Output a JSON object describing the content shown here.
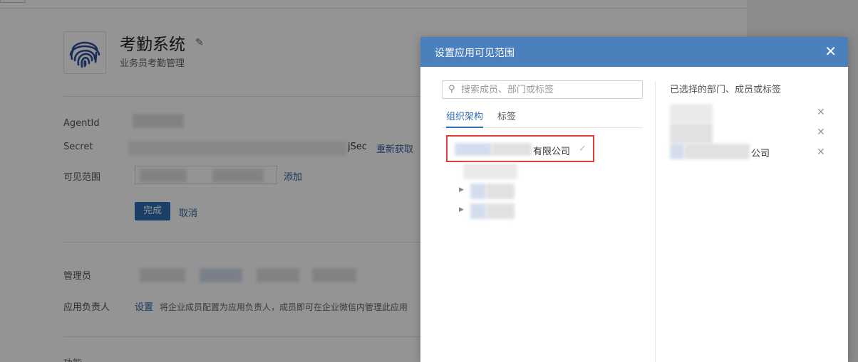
{
  "background": {
    "app_title": "考勤系统",
    "app_subtitle": "业务员考勤管理",
    "fields": {
      "agentid_label": "AgentId",
      "secret_label": "Secret",
      "secret_suffix": "jSec",
      "regenerate_link": "重新获取",
      "scope_label": "可见范围",
      "add_link": "添加",
      "done_button": "完成",
      "cancel_link": "取消",
      "admins_label": "管理员",
      "owner_label": "应用负责人",
      "owner_set_link": "设置",
      "owner_hint": "将企业成员配置为应用负责人，成员即可在企业微信内管理此应用",
      "features_label": "功能"
    }
  },
  "dialog": {
    "title": "设置应用可见范围",
    "close_icon": "close-icon",
    "search_placeholder": "搜索成员、部门或标签",
    "tabs": [
      "组织架构",
      "标签"
    ],
    "tree_root_label": "有限公司",
    "selected_heading": "已选择的部门、成员或标签",
    "selected_items": [
      {
        "label": ""
      },
      {
        "label": ""
      },
      {
        "label": "公司"
      }
    ]
  },
  "colors": {
    "header_blue": "#4a80bc",
    "primary_button": "#2e6db3",
    "highlight_red": "#e03b3b",
    "link_blue": "#2b5f9e"
  }
}
